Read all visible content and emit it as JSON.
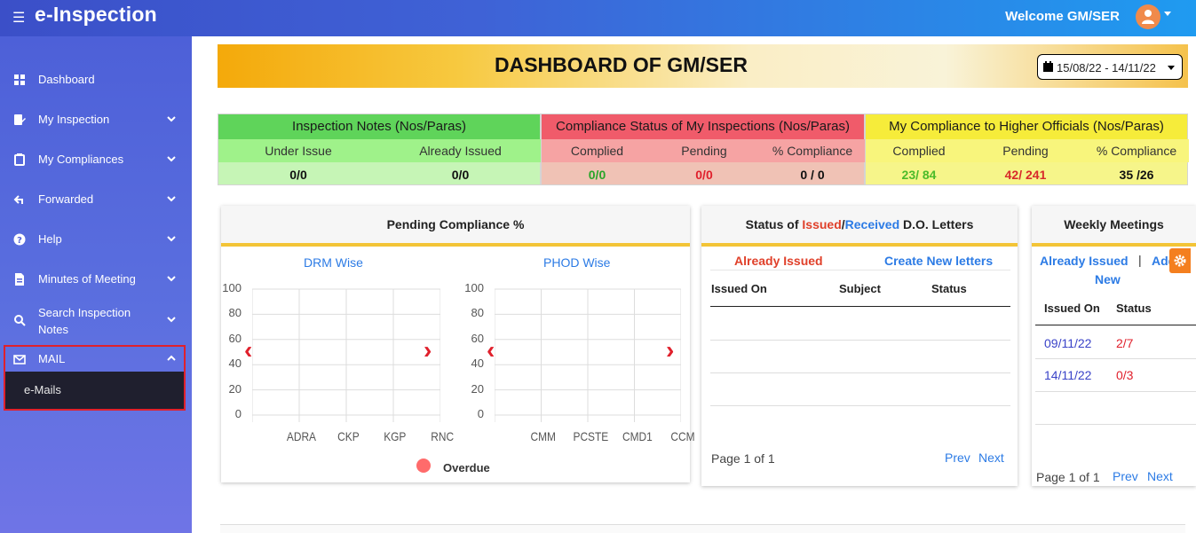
{
  "app": {
    "title": "e-Inspection",
    "welcome": "Welcome GM/SER"
  },
  "sidebar": {
    "items": [
      {
        "label": "Dashboard"
      },
      {
        "label": "My Inspection"
      },
      {
        "label": "My Compliances"
      },
      {
        "label": "Forwarded"
      },
      {
        "label": "Help"
      },
      {
        "label": "Minutes of Meeting"
      },
      {
        "label": "Search Inspection Notes"
      },
      {
        "label": "MAIL"
      }
    ],
    "submenu": {
      "label": "e-Mails"
    }
  },
  "header": {
    "title": "DASHBOARD OF GM/SER",
    "date_range": "15/08/22 - 14/11/22"
  },
  "stats": {
    "inspection_notes": {
      "title": "Inspection Notes (Nos/Paras)",
      "col1": "Under Issue",
      "col2": "Already Issued",
      "val1": "0/0",
      "val2": "0/0",
      "color": "#5fd45a"
    },
    "compliance_status": {
      "title": "Compliance Status of My Inspections (Nos/Paras)",
      "col1": "Complied",
      "col2": "Pending",
      "col3": "% Compliance",
      "val1": "0/0",
      "val2": "0/0",
      "val3": "0 / 0",
      "color": "#f05b6a"
    },
    "my_compliance": {
      "title": "My Compliance to Higher Officials (Nos/Paras)",
      "col1": "Complied",
      "col2": "Pending",
      "col3": "% Compliance",
      "val1": "23/ 84",
      "val2": "42/ 241",
      "val3": "35 /26",
      "color": "#f6ec3a"
    }
  },
  "pending_card": {
    "title": "Pending Compliance %",
    "legend": "Overdue",
    "left_sub": "DRM Wise",
    "right_sub": "PHOD Wise"
  },
  "chart_data": [
    {
      "type": "bar",
      "title": "DRM Wise",
      "categories": [
        "ADRA",
        "CKP",
        "KGP",
        "RNC"
      ],
      "series": [
        {
          "name": "Overdue",
          "values": [
            0,
            0,
            0,
            0
          ]
        }
      ],
      "ylim": [
        0,
        100
      ],
      "yticks": [
        "100",
        "80",
        "60",
        "40",
        "20",
        "0"
      ],
      "grid": true,
      "legend": "bottom"
    },
    {
      "type": "bar",
      "title": "PHOD Wise",
      "categories": [
        "CMM",
        "PCSTE",
        "CMD1",
        "CCM"
      ],
      "series": [
        {
          "name": "Overdue",
          "values": [
            0,
            0,
            0,
            0
          ]
        }
      ],
      "ylim": [
        0,
        100
      ],
      "yticks": [
        "100",
        "80",
        "60",
        "40",
        "20",
        "0"
      ],
      "grid": true,
      "legend": "bottom"
    }
  ],
  "do_card": {
    "title_pre": "Status of ",
    "title_issued": "Issued",
    "title_sep": "/",
    "title_received": "Received",
    "title_post": " D.O. Letters",
    "tab_issued": "Already Issued",
    "tab_create": "Create New letters",
    "columns": [
      "Issued On",
      "Subject",
      "Status"
    ],
    "pager": "Page 1 of 1",
    "prev": "Prev",
    "next": "Next"
  },
  "meetings_card": {
    "title": "Weekly Meetings",
    "tab_issued": "Already Issued",
    "tab_sep": "|",
    "tab_add": "Add",
    "tab_new": "New",
    "columns": [
      "Issued On",
      "Status"
    ],
    "rows": [
      {
        "date": "09/11/22",
        "status": "2/7"
      },
      {
        "date": "14/11/22",
        "status": "0/3"
      }
    ],
    "pager": "Page 1 of 1",
    "prev": "Prev",
    "next": "Next"
  }
}
